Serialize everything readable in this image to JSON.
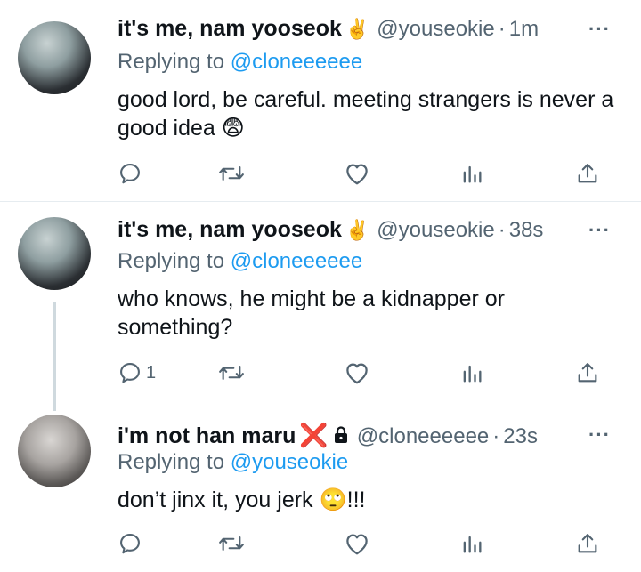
{
  "tweets": [
    {
      "display_name": "it's me, nam yooseok",
      "name_emoji": "✌️",
      "handle": "@youseokie",
      "time": "1m",
      "more": "···",
      "replying_label": "Replying to",
      "replying_handle": "@cloneeeeee",
      "text": "good lord, be careful. meeting strangers is never a good idea 😨",
      "reply_count": "",
      "icons": {
        "avatar": "avatar-image",
        "reply": "reply-icon",
        "retweet": "retweet-icon",
        "like": "like-icon",
        "analytics": "analytics-icon",
        "share": "share-icon"
      }
    },
    {
      "display_name": "it's me, nam yooseok",
      "name_emoji": "✌️",
      "handle": "@youseokie",
      "time": "38s",
      "more": "···",
      "replying_label": "Replying to",
      "replying_handle": "@cloneeeeee",
      "text": "who knows, he might be a kidnapper or something?",
      "reply_count": "1",
      "icons": {
        "avatar": "avatar-image",
        "reply": "reply-icon",
        "retweet": "retweet-icon",
        "like": "like-icon",
        "analytics": "analytics-icon",
        "share": "share-icon"
      }
    },
    {
      "display_name": "i'm not han maru",
      "name_emoji": "❌",
      "handle": "@cloneeeeee",
      "time": "23s",
      "more": "···",
      "replying_label": "Replying to",
      "replying_handle": "@youseokie",
      "text": "don’t jinx it, you jerk 🙄!!!",
      "reply_count": "",
      "icons": {
        "avatar": "avatar-image",
        "lock": "lock-icon",
        "reply": "reply-icon",
        "retweet": "retweet-icon",
        "like": "like-icon",
        "analytics": "analytics-icon",
        "share": "share-icon"
      }
    }
  ],
  "colors": {
    "text": "#0f1419",
    "secondary": "#536471",
    "link": "#1d9bf0",
    "divider": "#e6ecf0",
    "thread_line": "#cfd9de",
    "cross": "#e0245e"
  }
}
